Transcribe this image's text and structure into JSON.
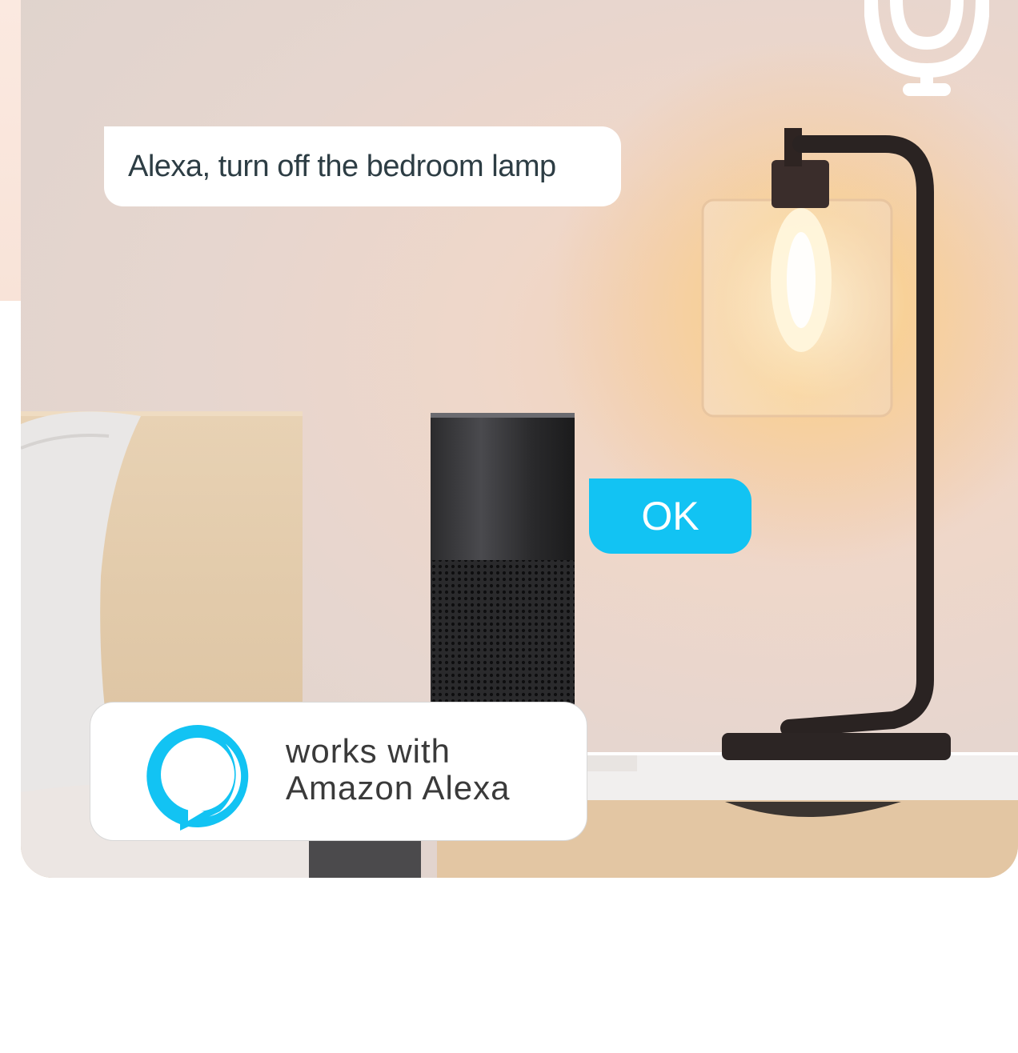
{
  "voice_command": "Alexa, turn off the bedroom lamp",
  "reply": "OK",
  "badge": {
    "line1": "works with",
    "line2": "Amazon Alexa"
  },
  "icons": {
    "mic": "microphone-icon",
    "logo": "alexa-logo-icon"
  },
  "colors": {
    "accent": "#12c3f3",
    "bubble_text": "#2d3d44",
    "badge_text": "#3a3a3a"
  }
}
